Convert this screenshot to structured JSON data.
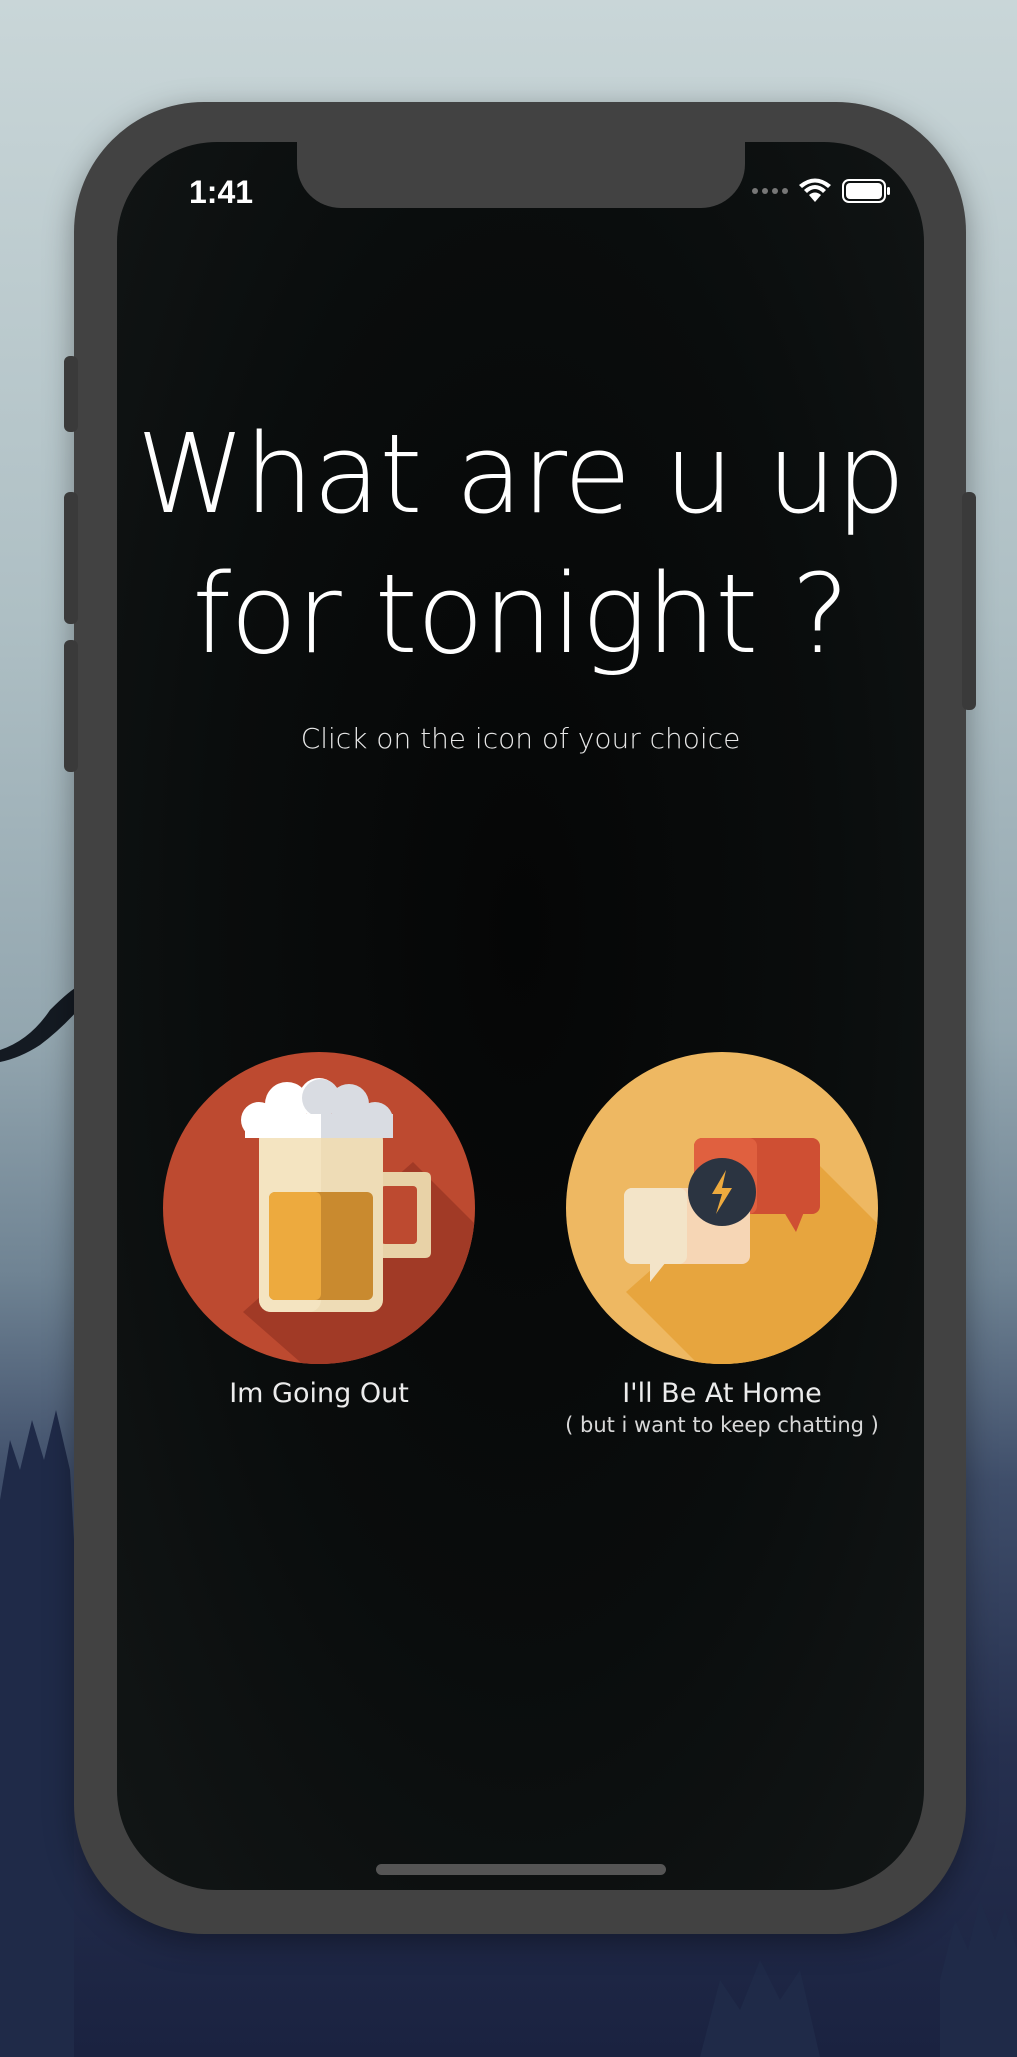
{
  "status_bar": {
    "time": "1:41"
  },
  "main": {
    "headline_line1": "What are u up",
    "headline_line2": "for tonight ?",
    "subtitle": "Click on the icon of your choice"
  },
  "choices": [
    {
      "label": "Im Going Out",
      "icon": "beer-mug-icon"
    },
    {
      "label": "I'll Be At Home",
      "sublabel": "( but i want to keep chatting )",
      "icon": "chat-bubbles-icon"
    }
  ],
  "colors": {
    "going_out_circle": "#BD4A30",
    "at_home_circle": "#EEB862",
    "screen_background": "#0A0C0C",
    "text": "#FFFFFF"
  }
}
